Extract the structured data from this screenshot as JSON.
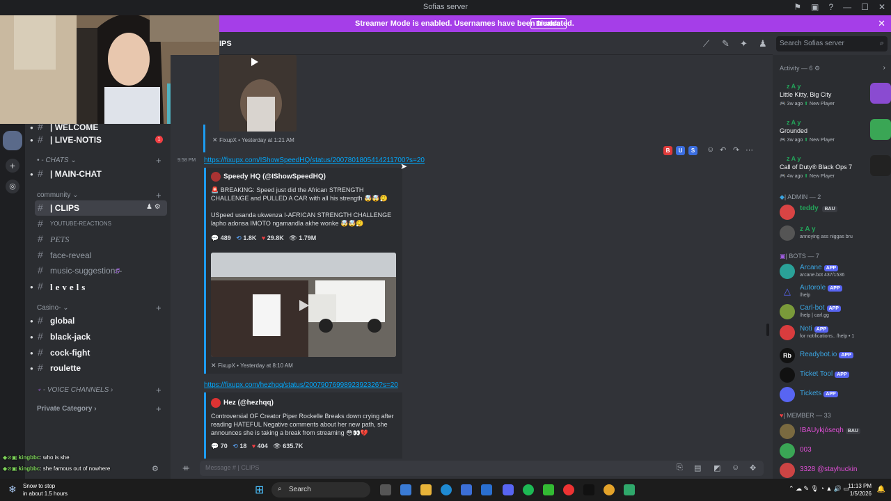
{
  "window": {
    "title": "Sofias server"
  },
  "banner": {
    "message": "Streamer Mode is enabled. Usernames have been truncated.",
    "button": "Disable"
  },
  "channel_header": {
    "title": "IPS",
    "search_placeholder": "Search Sofias server"
  },
  "sidebar": {
    "channels": [
      {
        "name": "| WELCOME",
        "bold": true
      },
      {
        "name": "| LIVE-NOTIS",
        "bold": true,
        "badge": "1"
      },
      {
        "category": "CHATS"
      },
      {
        "name": "| MAIN-CHAT",
        "bold": true
      },
      {
        "category": "community"
      },
      {
        "name": "| CLIPS",
        "selected": true
      },
      {
        "name": "YOUTUBE-REACTIONS"
      },
      {
        "name": "PETS"
      },
      {
        "name": "face-reveal"
      },
      {
        "name": "music-suggestions-"
      },
      {
        "name": "levels",
        "bold": true
      },
      {
        "category": "Casino"
      },
      {
        "name": "global",
        "bold": true
      },
      {
        "name": "black-jack",
        "bold": true
      },
      {
        "name": "cock-fight",
        "bold": true
      },
      {
        "name": "roulette",
        "bold": true
      },
      {
        "category": "VOICE CHANNELS"
      },
      {
        "category": "Private Category"
      }
    ]
  },
  "messages": [
    {
      "embed_footer": "FixupX • Yesterday at 1:21 AM"
    },
    {
      "time": "9:58 PM",
      "link": "https://fixupx.com/IShowSpeedHQ/status/2007801805414211700?s=20",
      "author": "Speedy HQ (@IShowSpeedHQ)",
      "desc1": "BREAKING: Speed just did the African STRENGTH CHALLENGE and PULLED A CAR with all his strength",
      "desc2": "USpeed usanda ukwenza I-AFRICAN STRENGTH CHALLENGE lapho adonsa IMOTO ngamandla akhe wonke",
      "stats": {
        "replies": "489",
        "retweets": "1.8K",
        "likes": "29.8K",
        "views": "1.79M"
      },
      "footer": "FixupX • Yesterday at 8:10 AM"
    },
    {
      "link": "https://fixupx.com/hezhqq/status/2007907699892392326?s=20",
      "author": "Hez (@hezhqq)",
      "desc": "Controversial OF Creator Piper Rockelle Breaks down crying after reading HATEFUL Negative comments about her new path, she announces she is taking a break from streaming",
      "stats": {
        "replies": "70",
        "retweets": "18",
        "likes": "404",
        "views": "635.7K"
      }
    }
  ],
  "reactions": [
    "B",
    "U",
    "S"
  ],
  "input": {
    "placeholder": "Message #  | CLIPS"
  },
  "members": {
    "activity_title": "Activity — 6",
    "activities": [
      {
        "name": "z A y",
        "game": "Little Kitty, Big City",
        "time": "3w ago",
        "tag": "New Player",
        "color": "#8a4bd1"
      },
      {
        "name": "z A y",
        "game": "Grounded",
        "time": "3w ago",
        "tag": "New Player",
        "color": "#3aa655"
      },
      {
        "name": "z A y",
        "game": "Call of Duty® Black Ops 7",
        "time": "4w ago",
        "tag": "New Player",
        "color": "#222222"
      }
    ],
    "admin_title": "| ADMIN — 2",
    "admins": [
      {
        "name": "teddy",
        "tag": "BAU",
        "color": "#23a55a"
      },
      {
        "name": "z A y",
        "sub": "annoying ass niggas bru",
        "color": "#23a55a"
      }
    ],
    "bots_title": "| BOTS — 7",
    "bots": [
      {
        "name": "Arcane",
        "sub": "arcane.bot 437/1536"
      },
      {
        "name": "Autorole",
        "sub": "/help"
      },
      {
        "name": "Carl-bot",
        "sub": "/help | carl.gg"
      },
      {
        "name": "Noti",
        "sub": "for notifications.. /help • 1"
      },
      {
        "name": "Readybot.io",
        "sub": ""
      },
      {
        "name": "Ticket Tool",
        "sub": ""
      },
      {
        "name": "Tickets",
        "sub": ""
      }
    ],
    "app_label": "APP",
    "member_title": "| MEMBER — 33",
    "users": [
      {
        "name": "!BAUykjóseqh",
        "tag": "BAU"
      },
      {
        "name": "003"
      },
      {
        "name": "3328 @stayhuckin"
      }
    ]
  },
  "twitch_chat": [
    {
      "user": "kingbbc",
      "text": ": who is she"
    },
    {
      "user": "kingbbc",
      "text": ": she famous out of nowhere"
    }
  ],
  "taskbar": {
    "weather_title": "Snow to stop",
    "weather_sub": "in about 1.5 hours",
    "search": "Search",
    "time": "11:13 PM",
    "date": "1/5/2026"
  }
}
